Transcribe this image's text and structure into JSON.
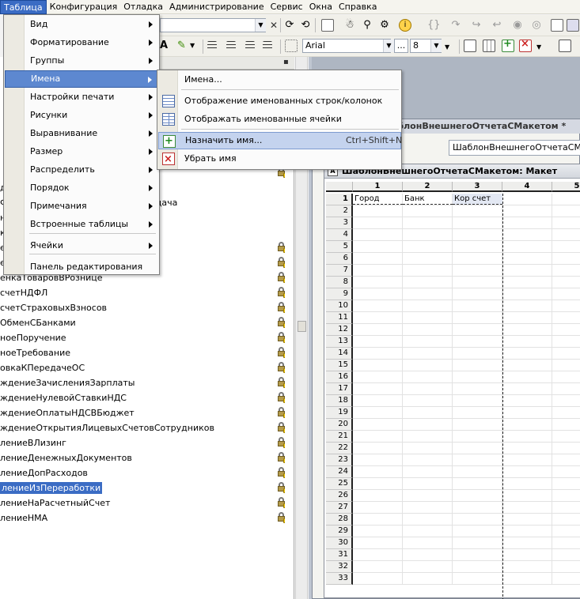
{
  "menubar": {
    "items": [
      "Таблица",
      "Конфигурация",
      "Отладка",
      "Администрирование",
      "Сервис",
      "Окна",
      "Справка"
    ]
  },
  "toolbar": {
    "font_name": "Arial",
    "font_size": "8",
    "ellipsis": "..."
  },
  "left_panel": {
    "rows": [
      {
        "text": "",
        "lock": true
      },
      {
        "text": "",
        "lock": true
      },
      {
        "text": "",
        "lock": true
      },
      {
        "text": "",
        "lock": true
      },
      {
        "text": "",
        "lock": true
      },
      {
        "text": "дача",
        "lock": false
      },
      {
        "text": "ФормаСпискаБезвозмезднаяПередача",
        "lock": false
      },
      {
        "text": "нанды",
        "lock": false
      },
      {
        "text": "кеты",
        "lock": false
      },
      {
        "text": "ещениеОС",
        "lock": true
      },
      {
        "text": "ещениеТоваров",
        "lock": true
      },
      {
        "text": "енкаТоваровВРознице",
        "lock": true
      },
      {
        "text": "счетНДФЛ",
        "lock": true
      },
      {
        "text": "счетСтраховыхВзносов",
        "lock": true
      },
      {
        "text": "ОбменСБанками",
        "lock": true
      },
      {
        "text": "ноеПоручение",
        "lock": true
      },
      {
        "text": "ноеТребование",
        "lock": true
      },
      {
        "text": "овкаКПередачеОС",
        "lock": true
      },
      {
        "text": "ждениеЗачисленияЗарплаты",
        "lock": true
      },
      {
        "text": "ждениеНулевойСтавкиНДС",
        "lock": true
      },
      {
        "text": "ждениеОплатыНДСВБюджет",
        "lock": true
      },
      {
        "text": "ждениеОткрытияЛицевыхСчетовСотрудников",
        "lock": true
      },
      {
        "text": "лениеВЛизинг",
        "lock": true
      },
      {
        "text": "лениеДенежныхДокументов",
        "lock": true
      },
      {
        "text": "лениеДопРасходов",
        "lock": true
      },
      {
        "text": "лениеИзПереработки",
        "lock": true,
        "selected": true
      },
      {
        "text": "лениеНаРасчетныйСчет",
        "lock": true
      },
      {
        "text": "лениеНМА",
        "lock": true
      }
    ]
  },
  "main_menu": {
    "items": [
      {
        "label": "Вид",
        "submenu": true
      },
      {
        "label": "Форматирование",
        "submenu": true
      },
      {
        "label": "Группы",
        "submenu": true
      },
      {
        "label": "Имена",
        "submenu": true,
        "highlighted": true
      },
      {
        "label": "Настройки печати",
        "submenu": true
      },
      {
        "label": "Рисунки",
        "submenu": true
      },
      {
        "label": "Выравнивание",
        "submenu": true
      },
      {
        "label": "Размер",
        "submenu": true
      },
      {
        "label": "Распределить",
        "submenu": true
      },
      {
        "label": "Порядок",
        "submenu": true
      },
      {
        "label": "Примечания",
        "submenu": true
      },
      {
        "label": "Встроенные таблицы",
        "submenu": true
      },
      {
        "label": "Ячейки",
        "submenu": true
      },
      {
        "label": "Панель редактирования",
        "submenu": false
      }
    ]
  },
  "names_submenu": {
    "items": [
      {
        "label": "Имена...",
        "shortcut": "",
        "icon": ""
      },
      {
        "label": "Отображение именованных строк/колонок",
        "shortcut": "",
        "icon": "named-rows-icon"
      },
      {
        "label": "Отображать именованные ячейки",
        "shortcut": "",
        "icon": "named-cells-icon"
      },
      {
        "label": "Назначить имя...",
        "shortcut": "Ctrl+Shift+N",
        "icon": "assign-name-icon",
        "highlighted": true
      },
      {
        "label": "Убрать имя",
        "shortcut": "",
        "icon": "remove-name-icon"
      }
    ]
  },
  "form_window": {
    "title": "аблонВнешнегоОтчетаСМакетом *",
    "name_field": "ШаблонВнешнегоОтчетаСМакетом"
  },
  "layout_window": {
    "title": "ШаблонВнешнегоОтчетаСМакетом: Макет",
    "columns": [
      "1",
      "2",
      "3",
      "4",
      "5"
    ],
    "rows": [
      "1",
      "2",
      "3",
      "4",
      "5",
      "6",
      "7",
      "8",
      "9",
      "10",
      "11",
      "12",
      "13",
      "14",
      "15",
      "16",
      "17",
      "18",
      "19",
      "20",
      "21",
      "22",
      "23",
      "24",
      "25",
      "26",
      "27",
      "28",
      "29",
      "30",
      "31",
      "32",
      "33"
    ],
    "header_cells": [
      "Город",
      "Банк",
      "Кор счет"
    ]
  }
}
